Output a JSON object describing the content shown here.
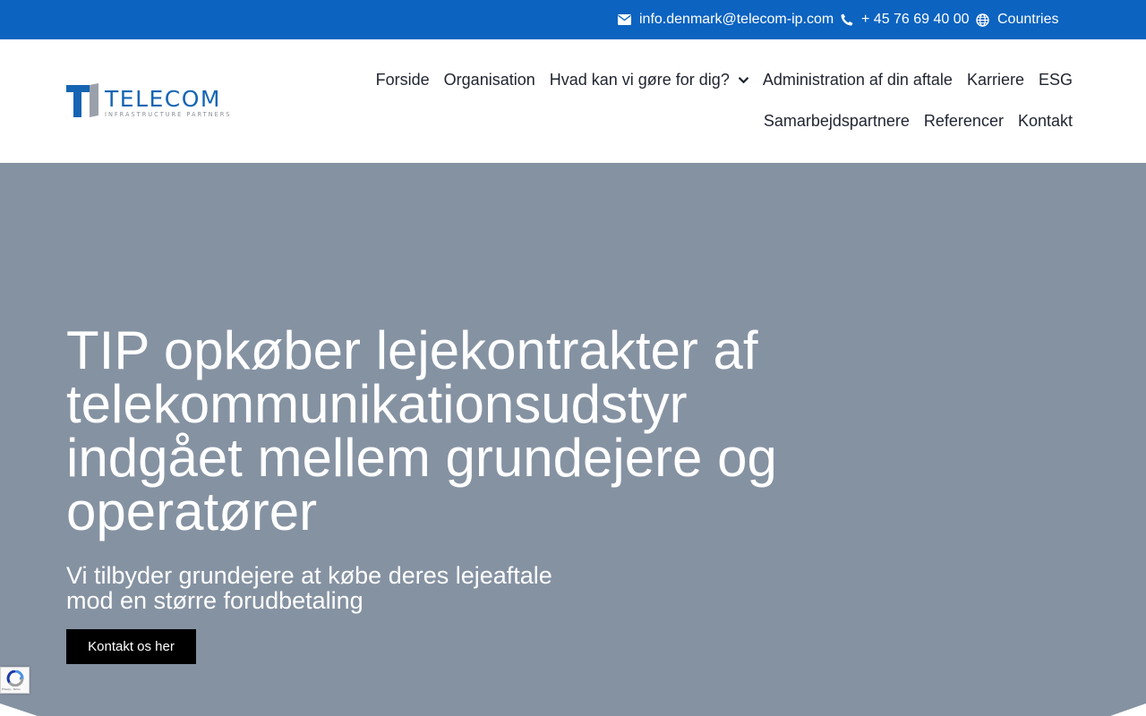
{
  "topbar": {
    "email": "info.denmark@telecom-ip.com",
    "phone": "+ 45 76 69 40 00",
    "countries": "Countries",
    "background_color": "#0c63c0"
  },
  "logo": {
    "word": "TELECOM",
    "subtitle": "INFRASTRUCTURE PARTNERS",
    "brand_color": "#1565b3"
  },
  "nav": {
    "row1": [
      {
        "label": "Forside"
      },
      {
        "label": "Organisation"
      },
      {
        "label": "Hvad kan vi gøre for dig?",
        "icon": "chevron-down-icon"
      },
      {
        "label": "Administration af din aftale"
      },
      {
        "label": "Karriere"
      },
      {
        "label": "ESG"
      }
    ],
    "row2": [
      {
        "label": "Samarbejdspartnere"
      },
      {
        "label": "Referencer"
      },
      {
        "label": "Kontakt"
      }
    ]
  },
  "hero": {
    "title": "TIP opkøber lejekontrakter af telekommunikationsudstyr indgået mellem grundejere og operatører",
    "subtitle": "Vi tilbyder grundejere at købe deres lejeaftale mod en større forudbetaling",
    "cta_label": "Kontakt os her",
    "background_color": "#8592a2"
  },
  "recaptcha": {
    "text": "Privacy - Terms"
  }
}
